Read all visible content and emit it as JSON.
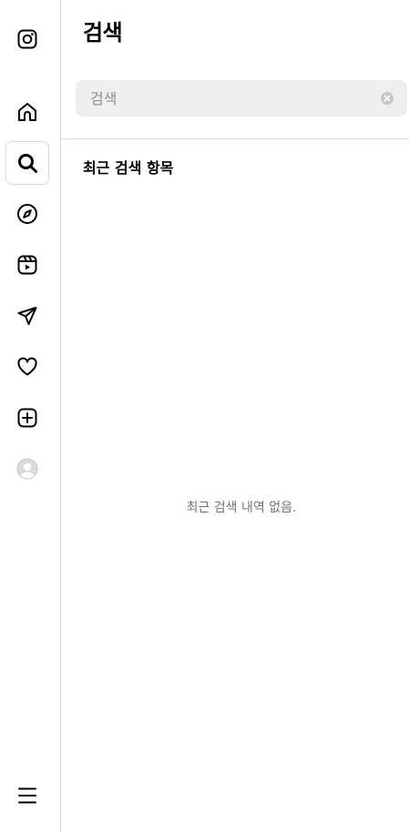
{
  "panel": {
    "title": "검색",
    "search": {
      "placeholder": "검색",
      "value": ""
    },
    "recent": {
      "heading": "최근 검색 항목",
      "empty_message": "최근 검색 내역 없음."
    }
  },
  "nav": {
    "items": [
      {
        "icon": "instagram-logo-icon"
      },
      {
        "icon": "home-icon"
      },
      {
        "icon": "search-icon",
        "active": true
      },
      {
        "icon": "explore-compass-icon"
      },
      {
        "icon": "reels-icon"
      },
      {
        "icon": "messages-paper-plane-icon"
      },
      {
        "icon": "notifications-heart-icon"
      },
      {
        "icon": "create-plus-icon"
      },
      {
        "icon": "profile-avatar-icon"
      },
      {
        "icon": "more-menu-icon"
      }
    ]
  },
  "colors": {
    "border": "#dbdbdb",
    "search_bg": "#efefef",
    "muted_text": "#737373",
    "placeholder": "#8e8e8e"
  }
}
